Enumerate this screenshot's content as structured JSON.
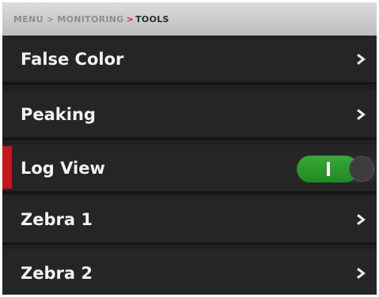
{
  "breadcrumb": {
    "items": [
      "MENU",
      "MONITORING",
      "TOOLS"
    ],
    "separator": ">"
  },
  "menu": {
    "items": [
      {
        "label": "False Color",
        "type": "submenu",
        "icon": "chevron-right-icon"
      },
      {
        "label": "Peaking",
        "type": "submenu",
        "icon": "chevron-right-icon"
      },
      {
        "label": "Log View",
        "type": "toggle",
        "state": "on",
        "selected": true
      },
      {
        "label": "Zebra 1",
        "type": "submenu",
        "icon": "chevron-right-icon"
      },
      {
        "label": "Zebra 2",
        "type": "submenu",
        "icon": "chevron-right-icon"
      }
    ]
  },
  "colors": {
    "accent_red": "#c8141e",
    "toggle_on_green": "#2a9a2c",
    "background": "#252525"
  }
}
